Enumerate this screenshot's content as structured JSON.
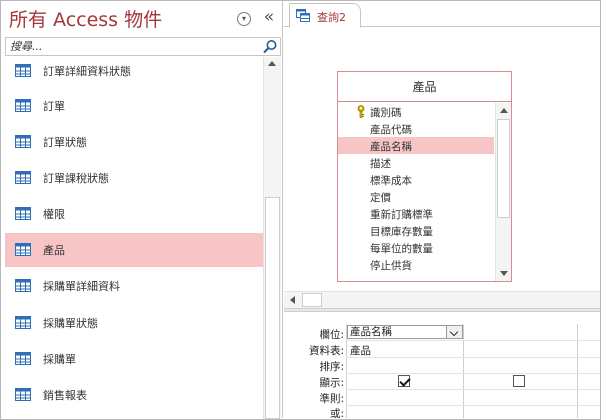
{
  "nav": {
    "title": "所有 Access 物件",
    "search_placeholder": "搜尋...",
    "items": [
      {
        "label": "訂單詳細資料狀態",
        "selected": false
      },
      {
        "label": "訂單",
        "selected": false
      },
      {
        "label": "訂單狀態",
        "selected": false
      },
      {
        "label": "訂單課稅狀態",
        "selected": false
      },
      {
        "label": "權限",
        "selected": false
      },
      {
        "label": "產品",
        "selected": true
      },
      {
        "label": "採購單詳細資料",
        "selected": false
      },
      {
        "label": "採購單狀態",
        "selected": false
      },
      {
        "label": "採購單",
        "selected": false
      },
      {
        "label": "銷售報表",
        "selected": false
      }
    ],
    "icons": {
      "menu": "chevron-down-circle-icon",
      "collapse": "double-chevron-left-icon",
      "search": "search-icon",
      "item": "table-icon"
    }
  },
  "document": {
    "tab_label": "查詢2",
    "tab_icon": "query-icon",
    "table_window": {
      "title": "產品",
      "fields": [
        {
          "label": "識別碼",
          "primary_key": true,
          "selected": false
        },
        {
          "label": "產品代碼",
          "primary_key": false,
          "selected": false
        },
        {
          "label": "產品名稱",
          "primary_key": false,
          "selected": true
        },
        {
          "label": "描述",
          "primary_key": false,
          "selected": false
        },
        {
          "label": "標準成本",
          "primary_key": false,
          "selected": false
        },
        {
          "label": "定價",
          "primary_key": false,
          "selected": false
        },
        {
          "label": "重新訂購標準",
          "primary_key": false,
          "selected": false
        },
        {
          "label": "目標庫存數量",
          "primary_key": false,
          "selected": false
        },
        {
          "label": "每單位的數量",
          "primary_key": false,
          "selected": false
        },
        {
          "label": "停止供貨",
          "primary_key": false,
          "selected": false
        }
      ]
    },
    "grid": {
      "row_labels": {
        "field": "欄位:",
        "table": "資料表:",
        "sort": "排序:",
        "show": "顯示:",
        "criteria": "準則:",
        "or": "或:"
      },
      "columns": [
        {
          "field": "產品名稱",
          "table": "產品",
          "show": true
        },
        {
          "field": "",
          "table": "",
          "show": false
        }
      ]
    }
  },
  "colors": {
    "accent": "#a4373a",
    "selection": "#f8c5c7",
    "table_border": "#d98b90"
  }
}
